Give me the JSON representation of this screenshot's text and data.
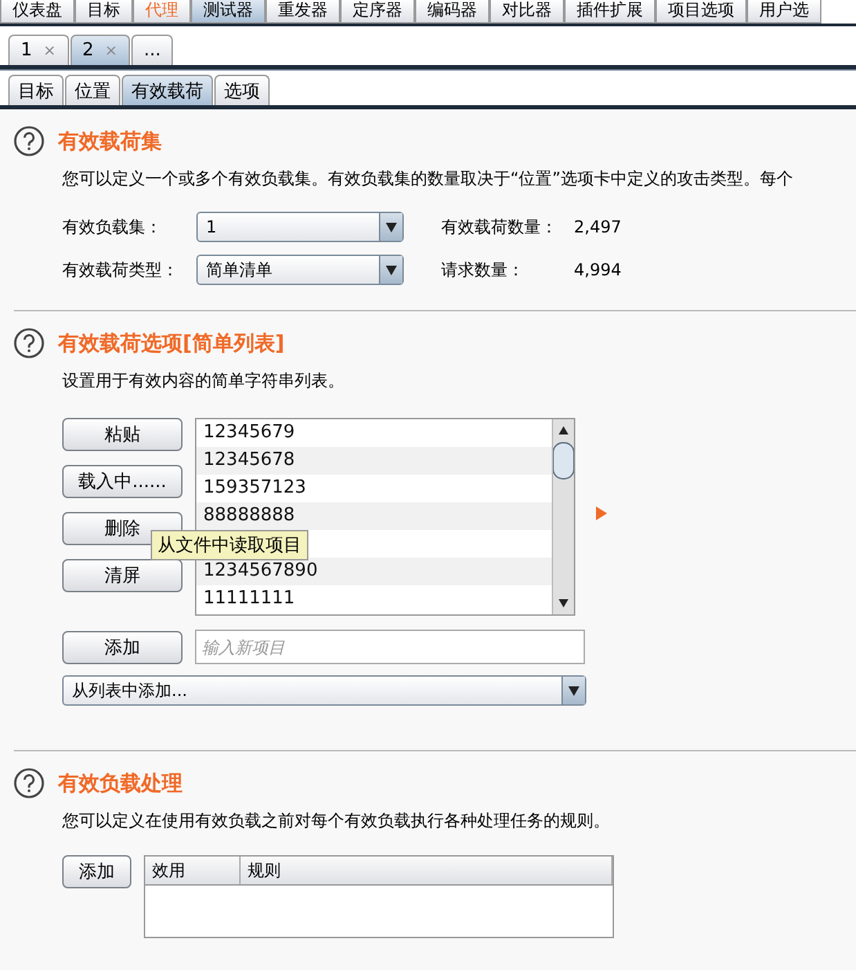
{
  "main_tabs": [
    {
      "label": "仪表盘",
      "selected": false,
      "highlighted": false
    },
    {
      "label": "目标",
      "selected": false,
      "highlighted": false
    },
    {
      "label": "代理",
      "selected": false,
      "highlighted": true
    },
    {
      "label": "测试器",
      "selected": true,
      "highlighted": false
    },
    {
      "label": "重发器",
      "selected": false,
      "highlighted": false
    },
    {
      "label": "定序器",
      "selected": false,
      "highlighted": false
    },
    {
      "label": "编码器",
      "selected": false,
      "highlighted": false
    },
    {
      "label": "对比器",
      "selected": false,
      "highlighted": false
    },
    {
      "label": "插件扩展",
      "selected": false,
      "highlighted": false
    },
    {
      "label": "项目选项",
      "selected": false,
      "highlighted": false
    },
    {
      "label": "用户选",
      "selected": false,
      "highlighted": false
    }
  ],
  "attack_tabs": [
    {
      "label": "1",
      "close": "×",
      "selected": false
    },
    {
      "label": "2",
      "close": "×",
      "selected": true
    },
    {
      "label": "...",
      "selected": false
    }
  ],
  "sub_tabs": [
    {
      "label": "目标",
      "selected": false
    },
    {
      "label": "位置",
      "selected": false
    },
    {
      "label": "有效载荷",
      "selected": true
    },
    {
      "label": "选项",
      "selected": false
    }
  ],
  "payload_sets": {
    "title": "有效载荷集",
    "description": "您可以定义一个或多个有效负载集。有效负载集的数量取决于“位置”选项卡中定义的攻击类型。每个",
    "fields": [
      {
        "label": "有效负载集：",
        "value": "1",
        "stat_label": "有效载荷数量：",
        "stat_value": "2,497"
      },
      {
        "label": "有效载荷类型：",
        "value": "简单清单",
        "stat_label": "请求数量：",
        "stat_value": "4,994"
      }
    ]
  },
  "payload_options": {
    "title": "有效载荷选项[简单列表]",
    "description": "设置用于有效内容的简单字符串列表。",
    "buttons": [
      "粘贴",
      "载入中......",
      "删除",
      "清屏"
    ],
    "items": [
      {
        "kind": "text",
        "text": "12345679"
      },
      {
        "kind": "text",
        "text": "12345678"
      },
      {
        "kind": "text",
        "text": "159357123"
      },
      {
        "kind": "text",
        "text": "88888888"
      },
      {
        "kind": "covered"
      },
      {
        "kind": "text",
        "text": "1234567890"
      },
      {
        "kind": "text",
        "text": "11111111"
      }
    ],
    "tooltip": "从文件中读取项目",
    "add_button": "添加",
    "new_item": {
      "placeholder": "输入新项目"
    },
    "add_from_list": "从列表中添加..."
  },
  "payload_processing": {
    "title": "有效负载处理",
    "description": "您可以定义在使用有效负载之前对每个有效负载执行各种处理任务的规则。",
    "add_button": "添加",
    "columns": [
      "效用",
      "规则"
    ]
  }
}
